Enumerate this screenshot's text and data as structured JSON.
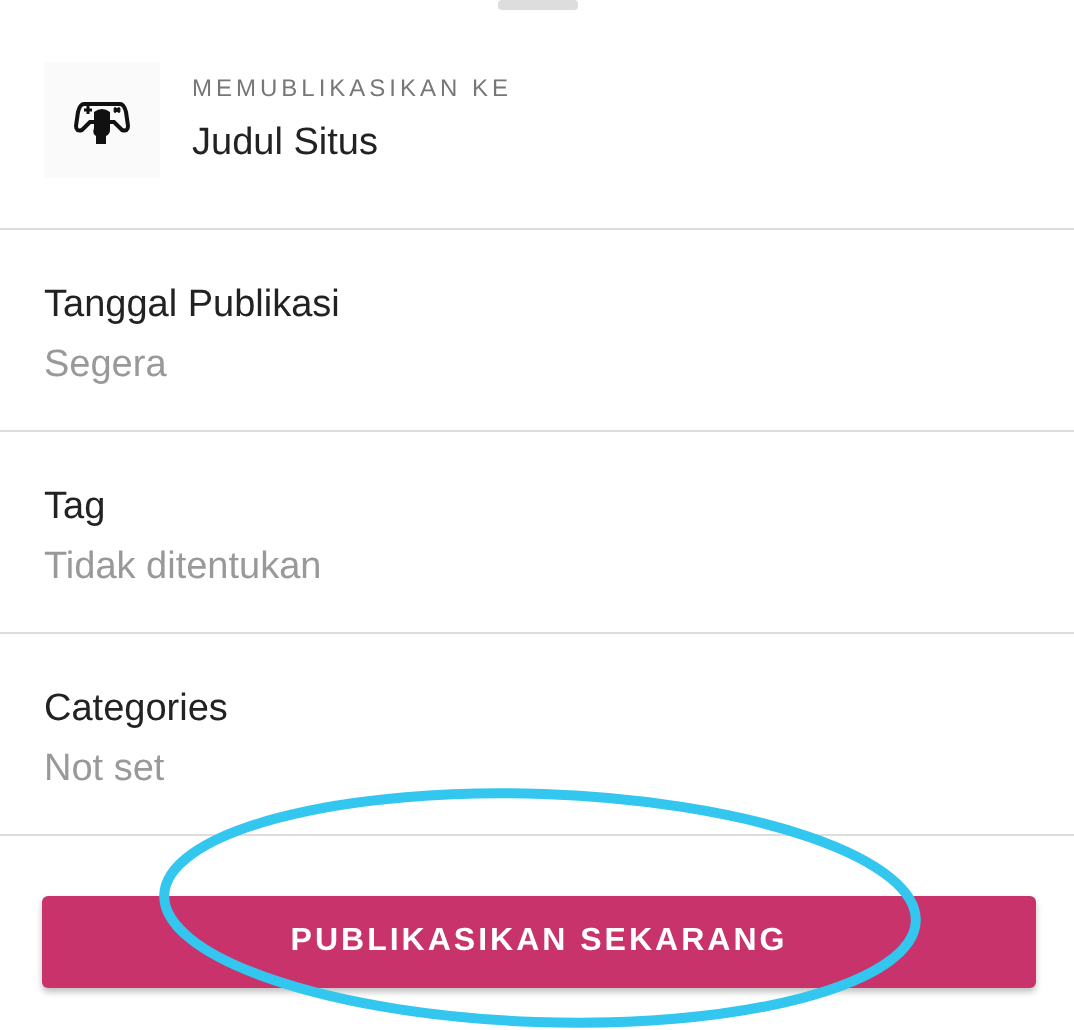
{
  "publish_target": {
    "caption": "MEMUBLIKASIKAN KE",
    "site_title": "Judul Situs"
  },
  "settings": [
    {
      "label": "Tanggal Publikasi",
      "value": "Segera"
    },
    {
      "label": "Tag",
      "value": "Tidak ditentukan"
    },
    {
      "label": "Categories",
      "value": "Not set"
    }
  ],
  "publish_button": {
    "label": "PUBLIKASIKAN SEKARANG"
  }
}
